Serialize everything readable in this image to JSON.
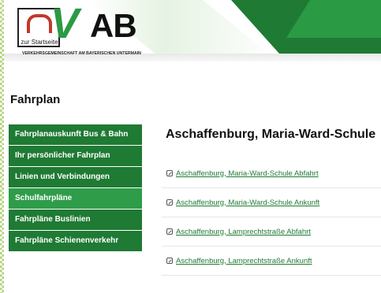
{
  "header": {
    "logo_start_label": "zur Startseite",
    "logo_letters_v": "V",
    "logo_letters_ab": "AB",
    "logo_subtitle": "VERKEHRSGEMEINSCHAFT AM BAYERISCHEN UNTERMAIN"
  },
  "page_title": "Fahrplan",
  "sidebar": {
    "items": [
      {
        "label": "Fahrplanauskunft Bus & Bahn"
      },
      {
        "label": "Ihr persönlicher Fahrplan"
      },
      {
        "label": "Linien und Verbindungen"
      },
      {
        "label": "Schulfahrpläne"
      },
      {
        "label": "Fahrpläne Buslinien"
      },
      {
        "label": "Fahrpläne Schienenverkehr"
      }
    ]
  },
  "main": {
    "title": "Aschaffenburg, Maria-Ward-Schule",
    "links": [
      {
        "label": "Aschaffenburg, Maria-Ward-Schule Abfahrt"
      },
      {
        "label": "Aschaffenburg, Maria-Ward-Schule Ankunft"
      },
      {
        "label": "Aschaffenburg, Lamprechtstraße Abfahrt"
      },
      {
        "label": "Aschaffenburg, Lamprechtstraße Ankunft"
      }
    ]
  },
  "colors": {
    "brand_green": "#1f7a34",
    "active_green": "#2f9c4a",
    "accent_red": "#c0392b"
  },
  "icons": {
    "link": "external-link-icon"
  }
}
